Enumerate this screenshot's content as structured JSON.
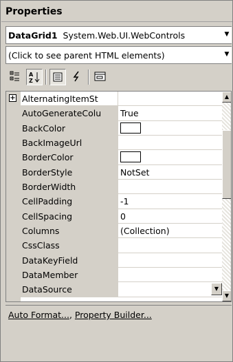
{
  "title": "Properties",
  "object_selector": {
    "name": "DataGrid1",
    "type": "System.Web.UI.WebControls"
  },
  "parent_selector": {
    "value": "(Click to see parent HTML elements)"
  },
  "toolbar": {
    "categorized_icon": "categorized-icon",
    "alphabetical_icon": "alphabetical-icon",
    "properties_icon": "properties-icon",
    "events_icon": "events-icon",
    "property_pages_icon": "property-pages-icon"
  },
  "properties": [
    {
      "name": "AlternatingItemSt",
      "value": ""
    },
    {
      "name": "AutoGenerateColu",
      "value": "True"
    },
    {
      "name": "BackColor",
      "value": "",
      "swatch": "#ffffff"
    },
    {
      "name": "BackImageUrl",
      "value": ""
    },
    {
      "name": "BorderColor",
      "value": "",
      "swatch": "#ffffff"
    },
    {
      "name": "BorderStyle",
      "value": "NotSet"
    },
    {
      "name": "BorderWidth",
      "value": ""
    },
    {
      "name": "CellPadding",
      "value": "-1"
    },
    {
      "name": "CellSpacing",
      "value": "0"
    },
    {
      "name": "Columns",
      "value": "(Collection)"
    },
    {
      "name": "CssClass",
      "value": ""
    },
    {
      "name": "DataKeyField",
      "value": ""
    },
    {
      "name": "DataMember",
      "value": ""
    },
    {
      "name": "DataSource",
      "value": ""
    }
  ],
  "verbs": {
    "auto_format": "Auto Format...",
    "separator": ", ",
    "property_builder": "Property Builder..."
  }
}
